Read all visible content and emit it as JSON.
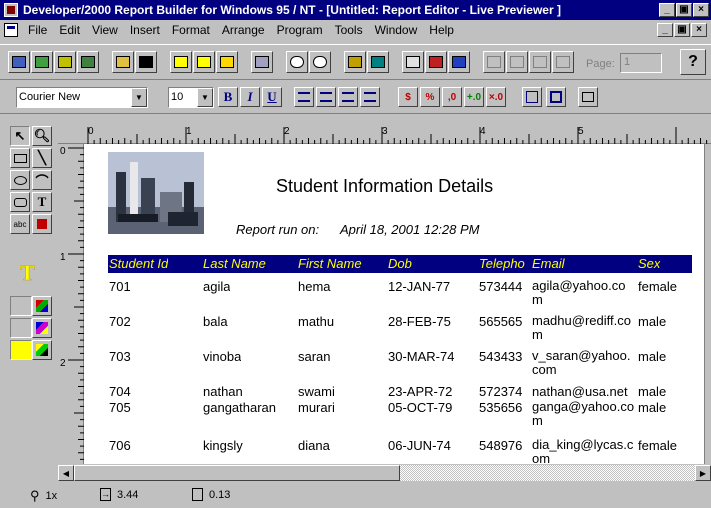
{
  "window": {
    "title": "Developer/2000 Report Builder for Windows 95 / NT - [Untitled: Report Editor - Live Previewer ]",
    "minimize": "_",
    "restore": "▣",
    "close": "×"
  },
  "menu": [
    "File",
    "Edit",
    "View",
    "Insert",
    "Format",
    "Arrange",
    "Program",
    "Tools",
    "Window",
    "Help"
  ],
  "toolbar": {
    "page_label": "Page:",
    "page_value": "1",
    "help_label": "?"
  },
  "format_bar": {
    "font": "Courier New",
    "font_size": "10",
    "bold": "B",
    "italic": "I",
    "underline": "U",
    "currency": "$",
    "percent": "%",
    "comma": ",0"
  },
  "tools": {
    "text_tool": "T",
    "field_tool": "abc",
    "highlight_color": "#ffff00",
    "ruler_marks": [
      "0",
      "1",
      "2",
      "3",
      "4",
      "5"
    ],
    "vruler_marks": [
      "0",
      "1",
      "2"
    ]
  },
  "report": {
    "title": "Student Information Details",
    "run_label": "Report run on:",
    "run_value": "April 18, 2001 12:28 PM",
    "columns": [
      "Student Id",
      "Last Name",
      "First Name",
      "Dob",
      "Telepho",
      "Email",
      "Sex"
    ],
    "rows": [
      {
        "id": "701",
        "last": "agila",
        "first": "hema",
        "dob": "12-JAN-77",
        "tel": "573444",
        "email": "agila@yahoo.com",
        "sex": "female"
      },
      {
        "id": "702",
        "last": "bala",
        "first": "mathu",
        "dob": "28-FEB-75",
        "tel": "565565",
        "email": "madhu@rediff.com",
        "sex": "male"
      },
      {
        "id": "703",
        "last": "vinoba",
        "first": "saran",
        "dob": "30-MAR-74",
        "tel": "543433",
        "email": "v_saran@yahoo.com",
        "sex": "male"
      },
      {
        "id": "704",
        "last": "nathan",
        "first": "swami",
        "dob": "23-APR-72",
        "tel": "572374",
        "email": "nathan@usa.net",
        "sex": "male"
      },
      {
        "id": "705",
        "last": "gangatharan",
        "first": "murari",
        "dob": "05-OCT-79",
        "tel": "535656",
        "email": "ganga@yahoo.com",
        "sex": "male"
      },
      {
        "id": "706",
        "last": "kingsly",
        "first": "diana",
        "dob": "06-JUN-74",
        "tel": "548976",
        "email": "dia_king@lycas.com",
        "sex": "female"
      }
    ]
  },
  "status": {
    "zoom": "1x",
    "position": "3.44",
    "offset": "0.13"
  },
  "colors": {
    "titlebar": "#000080",
    "header_bg": "#000080",
    "header_text": "#ffff00"
  }
}
